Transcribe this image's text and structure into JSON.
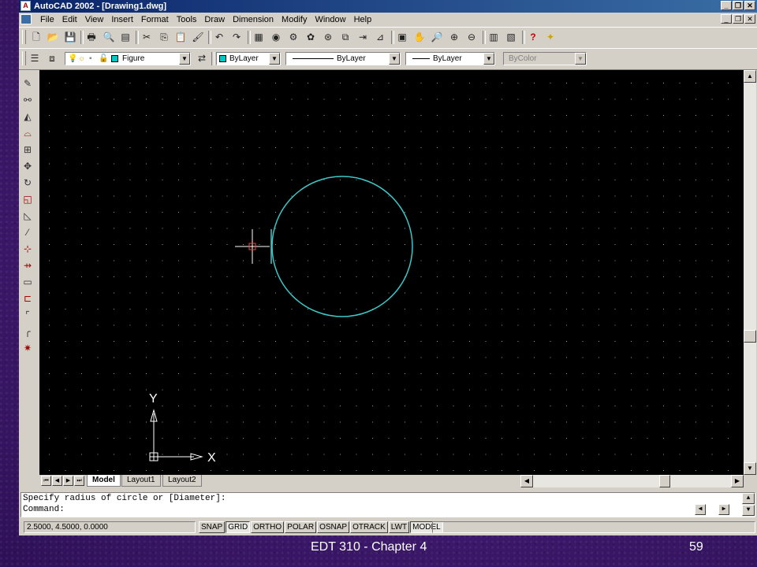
{
  "window": {
    "title": "AutoCAD 2002 - [Drawing1.dwg]",
    "app_icon": "autocad-icon",
    "controls": [
      "minimize-icon",
      "restore-icon",
      "close-icon"
    ]
  },
  "menubar": {
    "items": [
      "File",
      "Edit",
      "View",
      "Insert",
      "Format",
      "Tools",
      "Draw",
      "Dimension",
      "Modify",
      "Window",
      "Help"
    ]
  },
  "layer_toolbar": {
    "layer": "Figure",
    "layer_color": "#00c8c8",
    "color": "ByLayer",
    "color_swatch": "#00c8c8",
    "linetype": "ByLayer",
    "lineweight": "ByLayer",
    "plotstyle": "ByColor"
  },
  "drawing": {
    "background": "#000000",
    "circle_color": "#3ec6c6",
    "crosshair_color": "#ffffff",
    "ucs": {
      "x_label": "X",
      "y_label": "Y"
    }
  },
  "layout_tabs": [
    "Model",
    "Layout1",
    "Layout2"
  ],
  "active_tab": "Model",
  "command": {
    "line1": "Specify radius of circle or [Diameter]:",
    "line2": "Command:"
  },
  "status": {
    "coordinates": "2.5000, 4.5000, 0.0000",
    "buttons": [
      "SNAP",
      "GRID",
      "ORTHO",
      "POLAR",
      "OSNAP",
      "OTRACK",
      "LWT",
      "MODEL"
    ],
    "active": [
      "GRID",
      "MODEL"
    ]
  },
  "slide": {
    "footer_title": "EDT 310 - Chapter 4",
    "page_number": "59"
  }
}
